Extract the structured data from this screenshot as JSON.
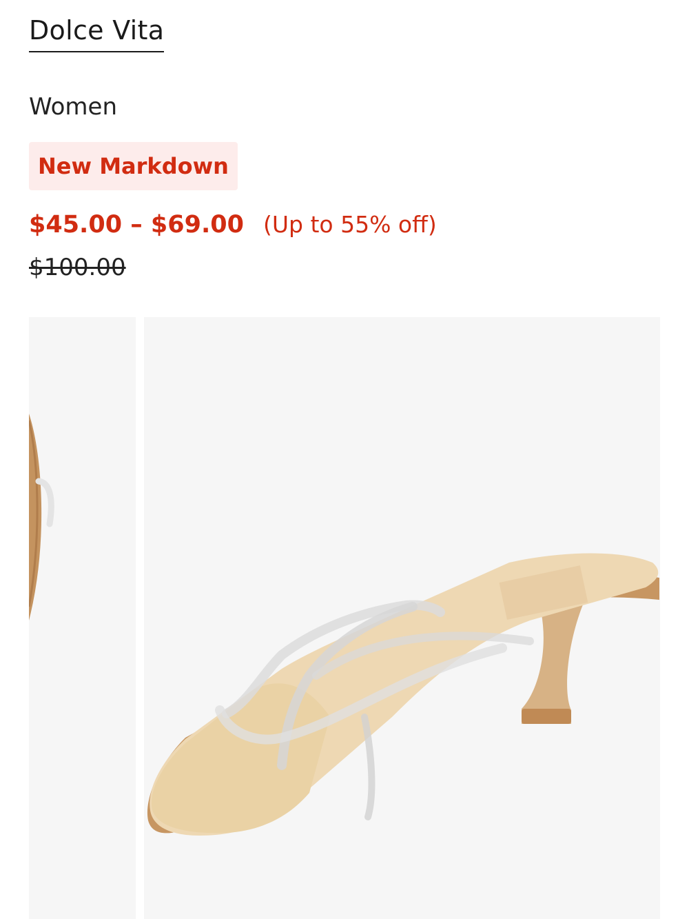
{
  "product": {
    "brand": "Dolce Vita",
    "category": "Women",
    "badge": "New Markdown",
    "price_range": "$45.00 – $69.00",
    "discount": "(Up to 55% off)",
    "original_price": "$100.00"
  },
  "gallery": {
    "images": [
      {
        "name": "thumbnail-side-view",
        "icon": "sandal-side-image"
      },
      {
        "name": "main-product-image",
        "icon": "sandal-main-image"
      }
    ]
  },
  "colors": {
    "sale_red": "#d12c11",
    "badge_bg": "#fdeceb",
    "image_bg": "#f6f6f6"
  }
}
